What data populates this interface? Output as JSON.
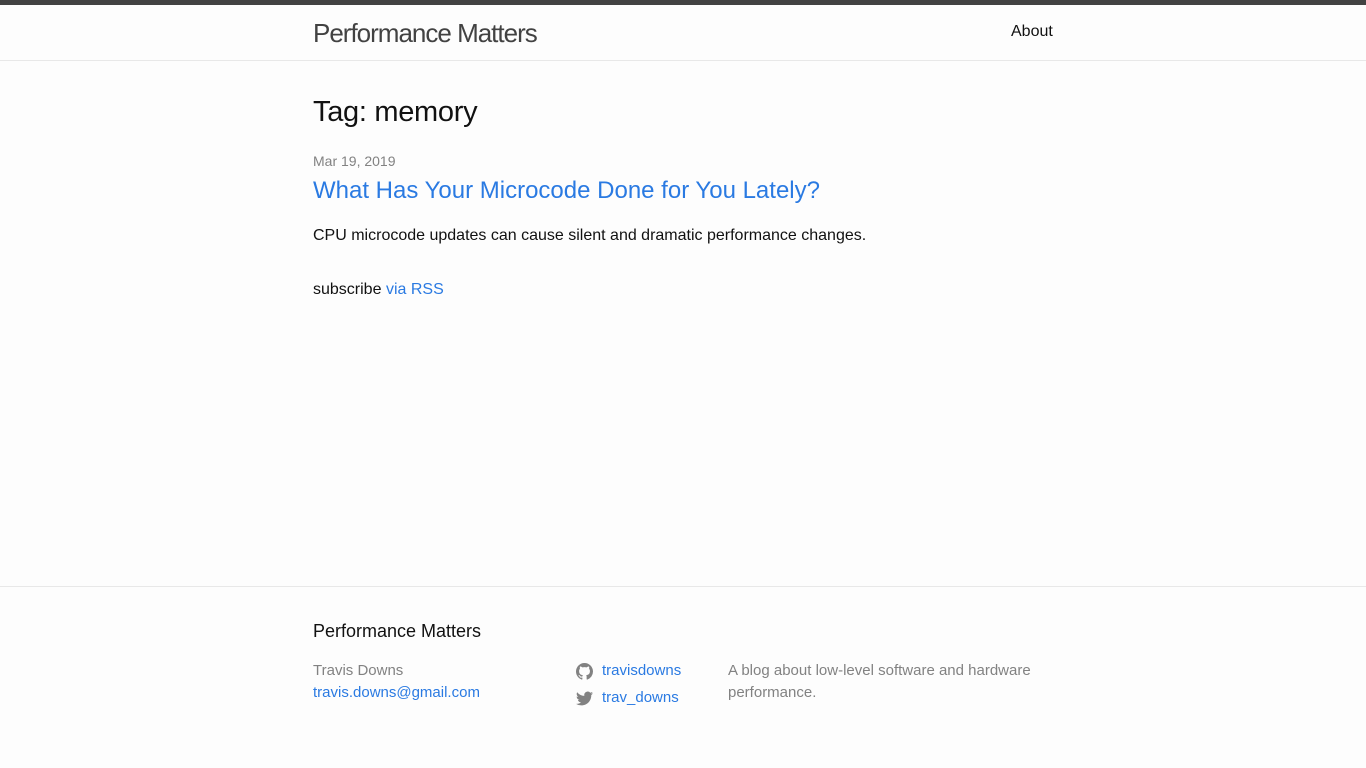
{
  "header": {
    "site_title": "Performance Matters",
    "nav": {
      "about_label": "About"
    }
  },
  "main": {
    "page_heading": "Tag: memory",
    "posts": [
      {
        "date": "Mar 19, 2019",
        "title": "What Has Your Microcode Done for You Lately?",
        "excerpt": "CPU microcode updates can cause silent and dramatic performance changes."
      }
    ],
    "rss": {
      "prefix": "subscribe",
      "link_label": "via RSS"
    }
  },
  "footer": {
    "heading": "Performance Matters",
    "author_name": "Travis Downs",
    "email": "travis.downs@gmail.com",
    "social": [
      {
        "icon": "github-icon",
        "username": "travisdowns"
      },
      {
        "icon": "twitter-icon",
        "username": "trav_downs"
      }
    ],
    "description": "A blog about low-level software and hardware performance."
  },
  "colors": {
    "link": "#2a7ae2",
    "text": "#111111",
    "muted": "#828282",
    "header_border_top": "#424242",
    "divider": "#e8e8e8",
    "background": "#fdfdfd"
  }
}
